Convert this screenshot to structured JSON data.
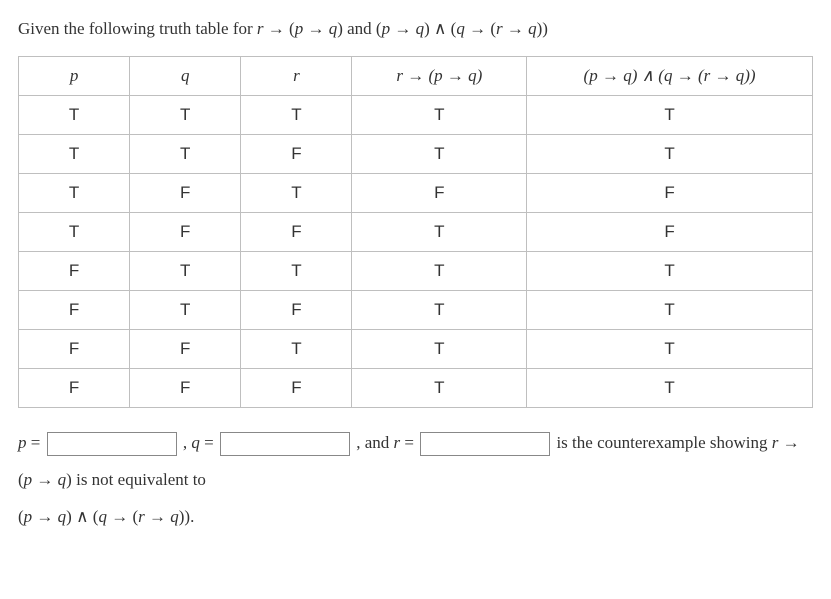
{
  "intro_prefix": "Given the following truth table for ",
  "intro_expr1": "r → (p → q)",
  "intro_mid": " and ",
  "intro_expr2": "(p → q) ∧ (q → (r → q))",
  "headers": {
    "p": "p",
    "q": "q",
    "r": "r",
    "e1": "r → (p → q)",
    "e2": "(p → q) ∧ (q → (r → q))"
  },
  "rows": [
    {
      "p": "T",
      "q": "T",
      "r": "T",
      "e1": "T",
      "e2": "T"
    },
    {
      "p": "T",
      "q": "T",
      "r": "F",
      "e1": "T",
      "e2": "T"
    },
    {
      "p": "T",
      "q": "F",
      "r": "T",
      "e1": "F",
      "e2": "F"
    },
    {
      "p": "T",
      "q": "F",
      "r": "F",
      "e1": "T",
      "e2": "F"
    },
    {
      "p": "F",
      "q": "T",
      "r": "T",
      "e1": "T",
      "e2": "T"
    },
    {
      "p": "F",
      "q": "T",
      "r": "F",
      "e1": "T",
      "e2": "T"
    },
    {
      "p": "F",
      "q": "F",
      "r": "T",
      "e1": "T",
      "e2": "T"
    },
    {
      "p": "F",
      "q": "F",
      "r": "F",
      "e1": "T",
      "e2": "T"
    }
  ],
  "answer": {
    "p_label": "p =",
    "p_val": "",
    "q_label": ", q =",
    "q_val": "",
    "r_label": ", and r =",
    "r_val": "",
    "tail1": " is the ",
    "tail2": "counterexample showing ",
    "expr1": "r → (p → q)",
    "mid": " is not equivalent to ",
    "expr2": "(p → q) ∧ (q → (r → q))",
    "period": "."
  }
}
